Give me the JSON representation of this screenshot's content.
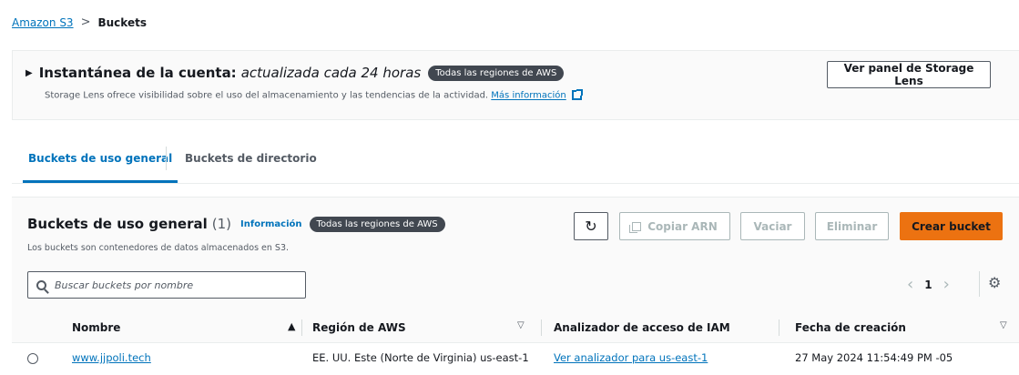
{
  "breadcrumb": {
    "root": "Amazon S3",
    "separator": ">",
    "current": "Buckets"
  },
  "snapshot": {
    "title_bold": "Instantánea de la cuenta:",
    "title_italic": "actualizada cada 24 horas",
    "regions_badge": "Todas las regiones de AWS",
    "description": "Storage Lens ofrece visibilidad sobre el uso del almacenamiento y las tendencias de la actividad.",
    "more_link": "Más información",
    "lens_button": "Ver panel de Storage Lens"
  },
  "tabs": [
    {
      "label": "Buckets de uso general",
      "active": true
    },
    {
      "label": "Buckets de directorio",
      "active": false
    }
  ],
  "panel": {
    "title": "Buckets de uso general",
    "count": "(1)",
    "info": "Información",
    "regions_badge": "Todas las regiones de AWS",
    "description": "Los buckets son contenedores de datos almacenados en S3.",
    "buttons": {
      "copy_arn": "Copiar ARN",
      "empty": "Vaciar",
      "delete": "Eliminar",
      "create": "Crear bucket"
    },
    "search_placeholder": "Buscar buckets por nombre",
    "page": "1"
  },
  "table": {
    "headers": [
      "Nombre",
      "Región de AWS",
      "Analizador de acceso de IAM",
      "Fecha de creación"
    ],
    "rows": [
      {
        "name": "www.jjpoli.tech",
        "region": "EE. UU. Este (Norte de Virginia) us-east-1",
        "analyzer": "Ver analizador para us-east-1",
        "created": "27 May 2024 11:54:49 PM -05"
      }
    ]
  },
  "colors": {
    "accent": "#0073bb",
    "primary_button": "#ec7211",
    "badge": "#414750"
  }
}
